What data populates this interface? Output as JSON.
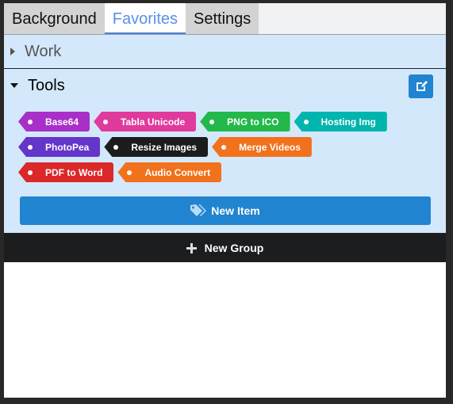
{
  "tabs": [
    {
      "label": "Background"
    },
    {
      "label": "Favorites",
      "active": true
    },
    {
      "label": "Settings"
    }
  ],
  "groups": {
    "work": {
      "title": "Work",
      "expanded": false
    },
    "tools": {
      "title": "Tools",
      "expanded": true,
      "items": [
        {
          "label": "Base64",
          "color": "#a830c8"
        },
        {
          "label": "Tabla Unicode",
          "color": "#e03a9c"
        },
        {
          "label": "PNG to ICO",
          "color": "#22b94a"
        },
        {
          "label": "Hosting Img",
          "color": "#00b5ad"
        },
        {
          "label": "PhotoPea",
          "color": "#6435c9"
        },
        {
          "label": "Resize Images",
          "color": "#1b1c1d"
        },
        {
          "label": "Merge Videos",
          "color": "#f2711c"
        },
        {
          "label": "PDF to Word",
          "color": "#db2828"
        },
        {
          "label": "Audio Convert",
          "color": "#f2711c"
        }
      ]
    }
  },
  "buttons": {
    "new_item": "New Item",
    "new_group": "New Group"
  }
}
